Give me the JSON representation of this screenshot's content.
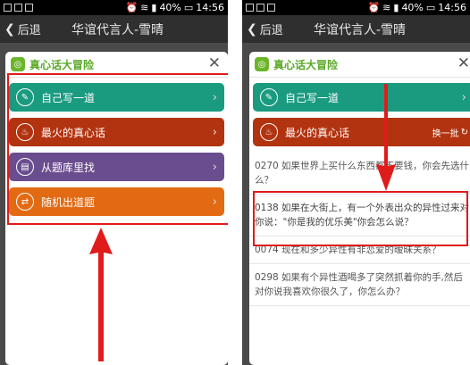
{
  "status_bar": {
    "battery": "40%",
    "time": "14:56"
  },
  "nav": {
    "back_label": "后退",
    "title": "华谊代言人-雪晴"
  },
  "dialog": {
    "title": "真心话大冒险",
    "close": "✕",
    "logo": "◎"
  },
  "menu": [
    {
      "label": "自己写一道",
      "icon": "pencil-icon",
      "icon_glyph": "✎",
      "color": "#1a9b80"
    },
    {
      "label": "最火的真心话",
      "icon": "fire-icon",
      "icon_glyph": "♨",
      "color": "#b2330f"
    },
    {
      "label": "从题库里找",
      "icon": "book-icon",
      "icon_glyph": "▤",
      "color": "#6a4d8e"
    },
    {
      "label": "随机出道题",
      "icon": "shuffle-icon",
      "icon_glyph": "⇄",
      "color": "#e26a13"
    }
  ],
  "refresh_label": "换一批",
  "questions": [
    "0270 如果世界上买什么东西都不要钱，你会先选什么？",
    "0138 如果在大街上，有一个外表出众的异性过来对你说：\"你是我的优乐美\"你会怎么说？",
    "0074 现在和多少异性有非恋爱的暧昧关系？",
    "0298 如果有个异性酒喝多了突然抓着你的手,然后对你说我喜欢你很久了，你怎么办？"
  ],
  "colors": {
    "highlight": "#e01b1b",
    "brand_green": "#5aa928"
  }
}
